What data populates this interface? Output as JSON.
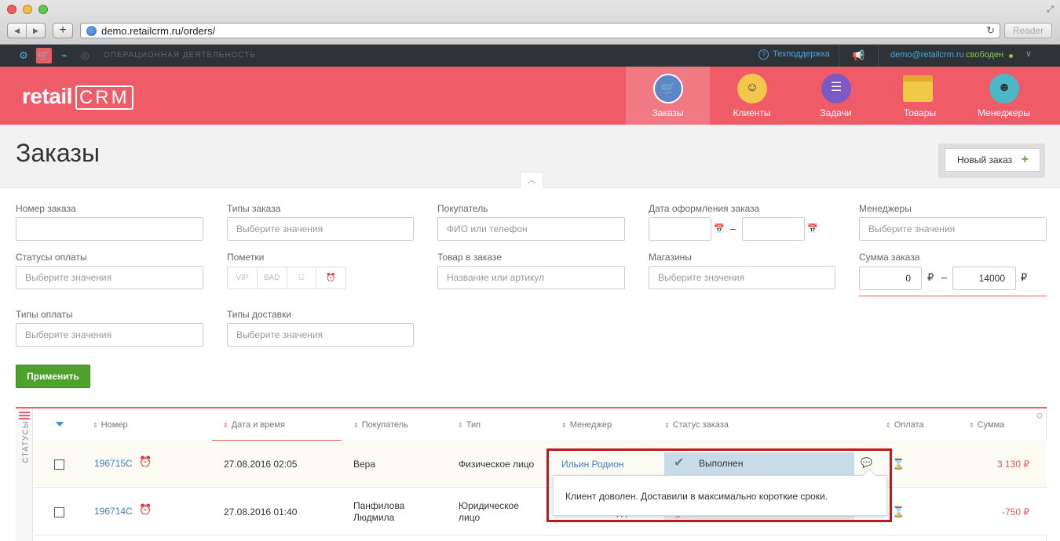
{
  "browser": {
    "url": "demo.retailcrm.ru/orders/",
    "reader_label": "Reader",
    "back_glyph": "◀",
    "forward_glyph": "▶",
    "add_glyph": "+",
    "reload_glyph": "↻",
    "fullscreen_glyph": "⤢"
  },
  "topbar": {
    "section_label": "ОПЕРАЦИОННАЯ ДЕЯТЕЛЬНОСТЬ",
    "support_label": "Техподдержка",
    "user_email": "demo@retailcrm.ru",
    "user_status": "свободен",
    "icons": {
      "settings": "⚙",
      "cart": "🛒",
      "analytics": "⌁",
      "target": "◎",
      "question": "?",
      "megaphone": "📢",
      "chevron": "∨"
    }
  },
  "header": {
    "logo_text": "retail",
    "logo_crm": "CRM",
    "tabs": [
      {
        "label": "Заказы"
      },
      {
        "label": "Клиенты"
      },
      {
        "label": "Задачи"
      },
      {
        "label": "Товары"
      },
      {
        "label": "Менеджеры"
      }
    ],
    "glyphs": {
      "cart": "🛒",
      "clients": "☺",
      "tasks": "☰",
      "managers": "☻"
    }
  },
  "page": {
    "title": "Заказы",
    "new_order_label": "Новый заказ",
    "plus_glyph": "+",
    "collapse_glyph": "︿"
  },
  "filters": {
    "order_number_label": "Номер заказа",
    "order_types_label": "Типы заказа",
    "order_types_placeholder": "Выберите значения",
    "customer_label": "Покупатель",
    "customer_placeholder": "ФИО или телефон",
    "date_label": "Дата оформления заказа",
    "date_dash": "–",
    "calendar_glyph": "📅",
    "managers_label": "Менеджеры",
    "managers_placeholder": "Выберите значения",
    "payment_status_label": "Статусы оплаты",
    "payment_status_placeholder": "Выберите значения",
    "marks_label": "Пометки",
    "marks": [
      "VIP",
      "BAD",
      "⍈",
      "⏰"
    ],
    "product_label": "Товар в заказе",
    "product_placeholder": "Название или артикул",
    "shops_label": "Магазины",
    "shops_placeholder": "Выберите значения",
    "sum_label": "Сумма заказа",
    "sum_from": "0",
    "sum_to": "14000",
    "currency": "₽",
    "sum_dash": "–",
    "payment_types_label": "Типы оплаты",
    "payment_types_placeholder": "Выберите значения",
    "delivery_types_label": "Типы доставки",
    "delivery_types_placeholder": "Выберите значения",
    "apply_label": "Применить"
  },
  "table": {
    "statuses_label": "СТАТУСЫ",
    "gear_glyph": "⚙",
    "sort_glyph": "⇕",
    "columns": {
      "number": "Номер",
      "datetime": "Дата и время",
      "customer": "Покупатель",
      "type": "Тип",
      "manager": "Менеджер",
      "status": "Статус заказа",
      "payment": "Оплата",
      "sum": "Сумма"
    },
    "rows": [
      {
        "number": "196715C",
        "datetime": "27.08.2016 02:05",
        "customer": "Вера",
        "type": "Физическое лицо",
        "manager": "Ильин Родион",
        "status": "Выполнен",
        "sum": "3 130 ₽"
      },
      {
        "number": "196714C",
        "datetime": "27.08.2016 01:40",
        "customer_line1": "Панфилова",
        "customer_line2": "Людмила",
        "type_line1": "Юридическое",
        "type_line2": "лицо",
        "manager_partial": "рд",
        "sum": "-750 ₽"
      }
    ],
    "glyphs": {
      "alarm": "⏰",
      "check": "✔",
      "comment": "💬",
      "hourglass": "⌛",
      "scissors": "✂"
    },
    "tooltip_text": "Клиент доволен. Доставили в максимально короткие сроки."
  }
}
